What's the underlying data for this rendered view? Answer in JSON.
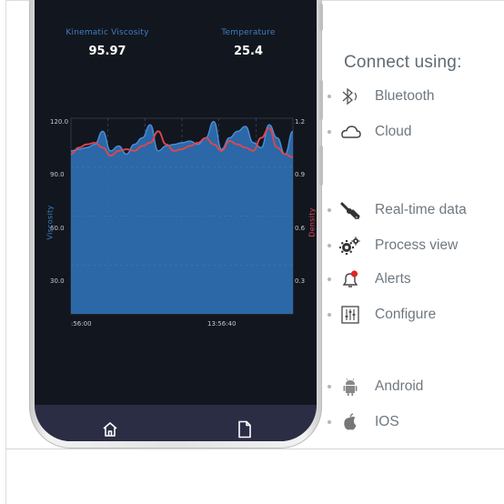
{
  "readings": {
    "viscosity_label": "Kinematic Viscosity",
    "viscosity_value": "95.97",
    "temperature_label": "Temperature",
    "temperature_value": "25.4"
  },
  "chart_data": {
    "type": "area",
    "y_left": {
      "label": "Viscosity",
      "ticks": [
        "120.0",
        "90.0",
        "60.0",
        "30.0"
      ],
      "range": [
        0,
        120
      ]
    },
    "y_right": {
      "label": "Density",
      "ticks": [
        "1.2",
        "0.9",
        "0.6",
        "0.3"
      ],
      "range": [
        0,
        1.2
      ]
    },
    "x_ticks": [
      ":56:00",
      "13:56:40"
    ],
    "grid": true,
    "series": [
      {
        "name": "Viscosity",
        "color": "#2f6fb3",
        "values": [
          100,
          101,
          102,
          104,
          112,
          100,
          103,
          98,
          104,
          108,
          116,
          100,
          103,
          104,
          105,
          106,
          104,
          108,
          118,
          101,
          108,
          112,
          115,
          105,
          102,
          116,
          108,
          98,
          112
        ]
      },
      {
        "name": "Density",
        "color": "#e0474c",
        "values": [
          0.98,
          1.02,
          1.04,
          1.05,
          1.02,
          0.97,
          1.0,
          1.01,
          1.0,
          1.03,
          1.05,
          1.12,
          1.04,
          1.0,
          1.01,
          1.03,
          1.05,
          1.08,
          1.04,
          1.0,
          1.06,
          1.04,
          1.02,
          1.0,
          1.08,
          1.14,
          1.02,
          0.98,
          0.96
        ]
      }
    ]
  },
  "nav": {
    "home_icon": "home-icon",
    "document_icon": "document-icon"
  },
  "side_panel": {
    "title": "Connect using:",
    "items": [
      {
        "label": "Bluetooth",
        "icon": "bluetooth-icon"
      },
      {
        "label": "Cloud",
        "icon": "cloud-icon"
      },
      {
        "label": "Real-time data",
        "icon": "satellite-icon"
      },
      {
        "label": "Process view",
        "icon": "gears-icon"
      },
      {
        "label": "Alerts",
        "icon": "bell-alert-icon"
      },
      {
        "label": "Configure",
        "icon": "sliders-icon"
      },
      {
        "label": "Android",
        "icon": "android-icon"
      },
      {
        "label": "IOS",
        "icon": "apple-icon"
      }
    ]
  },
  "colors": {
    "viscosity": "#2f6fb3",
    "density": "#e0474c",
    "screen_bg": "#12161f",
    "navbar_bg": "#2b2d45",
    "label_blue": "#3f7fbf",
    "alert_red": "#e02424"
  }
}
